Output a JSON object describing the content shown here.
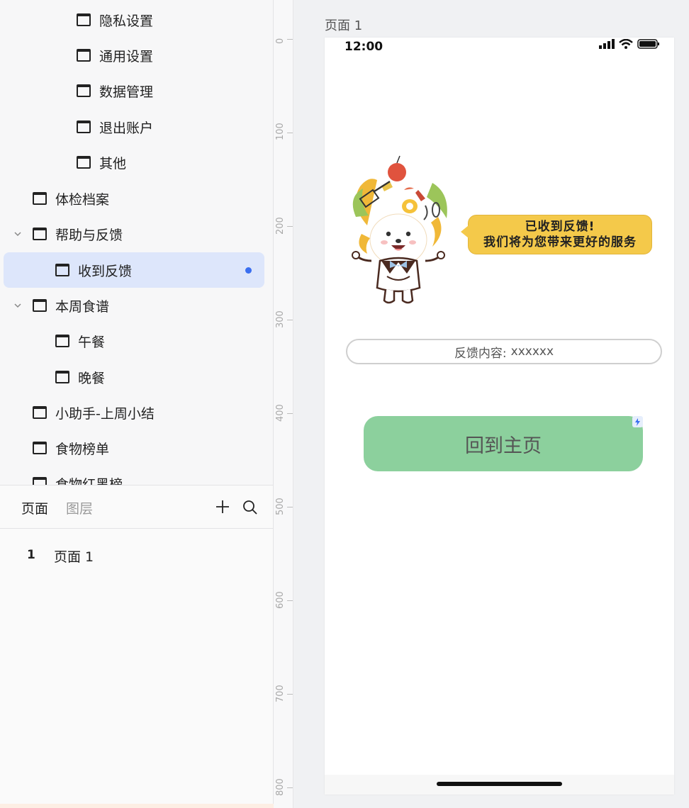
{
  "tree": {
    "items": [
      {
        "label": "隐私设置"
      },
      {
        "label": "通用设置"
      },
      {
        "label": "数据管理"
      },
      {
        "label": "退出账户"
      },
      {
        "label": "其他"
      },
      {
        "label": "体检档案"
      },
      {
        "label": "帮助与反馈"
      },
      {
        "label": "收到反馈"
      },
      {
        "label": "本周食谱"
      },
      {
        "label": "午餐"
      },
      {
        "label": "晚餐"
      },
      {
        "label": "小助手-上周小结"
      },
      {
        "label": "食物榜单"
      },
      {
        "label": "食物红黑榜"
      }
    ]
  },
  "pages_panel": {
    "tab_pages": "页面",
    "tab_layers": "图层",
    "pages": [
      {
        "number": "1",
        "name": "页面 1"
      }
    ]
  },
  "ruler": {
    "labels": [
      "0",
      "100",
      "200",
      "300",
      "400",
      "500",
      "600",
      "700",
      "800"
    ]
  },
  "canvas": {
    "title": "页面 1",
    "status_time": "12:00",
    "bubble": {
      "line1": "已收到反馈!",
      "line2": "我们将为您带来更好的服务"
    },
    "feedback": {
      "label": "反馈内容:",
      "value": "xxxxxx"
    },
    "home_button": "回到主页"
  },
  "colors": {
    "selected_bg": "#dde6fb",
    "accent_dot": "#3a6ff0",
    "button_green": "#8cd09d",
    "bubble_yellow": "#f4c94a"
  }
}
